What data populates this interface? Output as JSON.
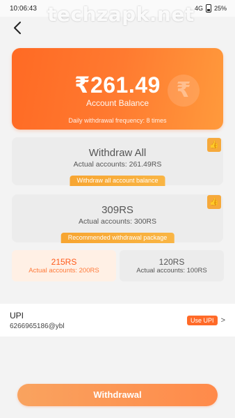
{
  "status_bar": {
    "time": "10:06:43",
    "network": "4G",
    "battery": "25%"
  },
  "watermark": "techzapk.net",
  "balance": {
    "amount": "₹261.49",
    "label": "Account Balance",
    "frequency": "Daily withdrawal frequency: 8 times"
  },
  "options": [
    {
      "title": "Withdraw All",
      "sub": "Actual accounts: 261.49RS",
      "tag": "Withdraw all account balance"
    },
    {
      "title": "309RS",
      "sub": "Actual accounts: 300RS",
      "tag": "Recommended withdrawal package"
    }
  ],
  "small_options": [
    {
      "title": "215RS",
      "sub": "Actual accounts: 200RS",
      "selected": true
    },
    {
      "title": "120RS",
      "sub": "Actual accounts: 100RS",
      "selected": false
    }
  ],
  "upi": {
    "title": "UPI",
    "id": "6266965186@ybl",
    "action": "Use UPI",
    "chevron": ">"
  },
  "withdraw_button": "Withdrawal",
  "colors": {
    "accent": "#ff6a24",
    "badge": "#f6a93b",
    "selected_bg": "#fff0e5"
  },
  "icons": {
    "back": "back-arrow-icon",
    "thumb": "thumbs-up-icon",
    "battery": "battery-icon",
    "rupee": "rupee-icon"
  }
}
